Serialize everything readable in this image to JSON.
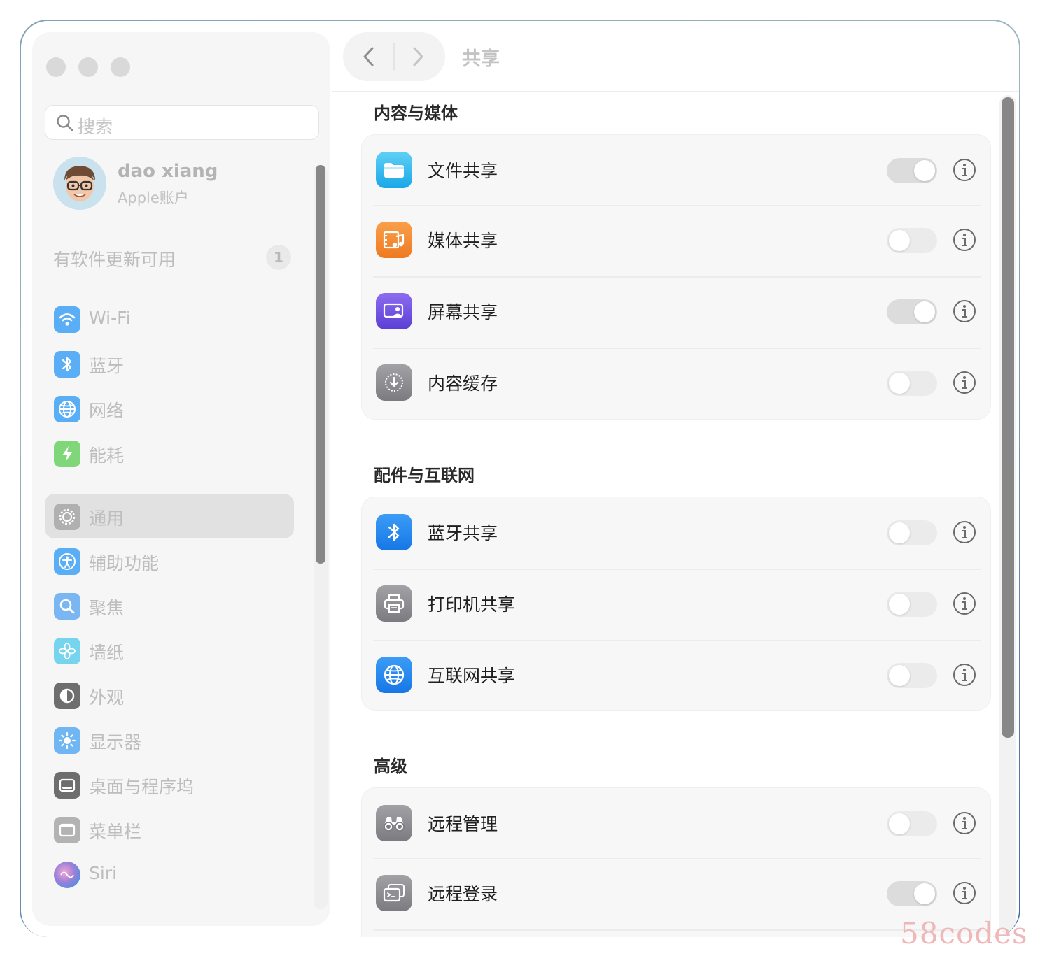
{
  "window": {
    "title": "共享"
  },
  "sidebar": {
    "search_placeholder": "搜索",
    "account": {
      "name": "dao xiang",
      "subtitle": "Apple账户"
    },
    "update": {
      "label": "有软件更新可用",
      "badge": "1"
    },
    "items": [
      {
        "label": "Wi-Fi",
        "icon": "wifi-icon",
        "color": "#5aaef5"
      },
      {
        "label": "蓝牙",
        "icon": "bluetooth-icon",
        "color": "#5aaef5"
      },
      {
        "label": "网络",
        "icon": "globe-icon",
        "color": "#5aaef5"
      },
      {
        "label": "能耗",
        "icon": "bolt-icon",
        "color": "#7fd77a"
      },
      {
        "label": "通用",
        "icon": "gear-icon",
        "color": "#b0b0b0",
        "selected": true
      },
      {
        "label": "辅助功能",
        "icon": "accessibility-icon",
        "color": "#5aaef5"
      },
      {
        "label": "聚焦",
        "icon": "magnifier-icon",
        "color": "#7ab7f2"
      },
      {
        "label": "墙纸",
        "icon": "flower-icon",
        "color": "#76d4ee"
      },
      {
        "label": "外观",
        "icon": "appearance-icon",
        "color": "#6e6e6e"
      },
      {
        "label": "显示器",
        "icon": "sun-icon",
        "color": "#6fb6f3"
      },
      {
        "label": "桌面与程序坞",
        "icon": "dock-icon",
        "color": "#6e6e6e"
      },
      {
        "label": "菜单栏",
        "icon": "menubar-icon",
        "color": "#b3b3b3"
      },
      {
        "label": "Siri",
        "icon": "siri-icon",
        "color": "#9a7fd8"
      }
    ]
  },
  "main": {
    "sections": [
      {
        "title": "内容与媒体",
        "rows": [
          {
            "label": "文件共享",
            "icon": "folder-icon",
            "color": "#33b4ef",
            "toggle": "on"
          },
          {
            "label": "媒体共享",
            "icon": "media-icon",
            "color": "#f28a2c",
            "toggle": "off"
          },
          {
            "label": "屏幕共享",
            "icon": "screen-share-icon",
            "color": "#6a4fe0",
            "toggle": "on"
          },
          {
            "label": "内容缓存",
            "icon": "download-icon",
            "color": "#8e8e93",
            "toggle": "off"
          }
        ]
      },
      {
        "title": "配件与互联网",
        "rows": [
          {
            "label": "蓝牙共享",
            "icon": "bluetooth-icon",
            "color": "#2d8cf0",
            "toggle": "off"
          },
          {
            "label": "打印机共享",
            "icon": "printer-icon",
            "color": "#8e8e93",
            "toggle": "off"
          },
          {
            "label": "互联网共享",
            "icon": "globe-icon",
            "color": "#2d8cf0",
            "toggle": "off"
          }
        ]
      },
      {
        "title": "高级",
        "rows": [
          {
            "label": "远程管理",
            "icon": "binoculars-icon",
            "color": "#8e8e93",
            "toggle": "off"
          },
          {
            "label": "远程登录",
            "icon": "terminal-icon",
            "color": "#8e8e93",
            "toggle": "on"
          }
        ]
      }
    ]
  },
  "watermark": "58codes"
}
